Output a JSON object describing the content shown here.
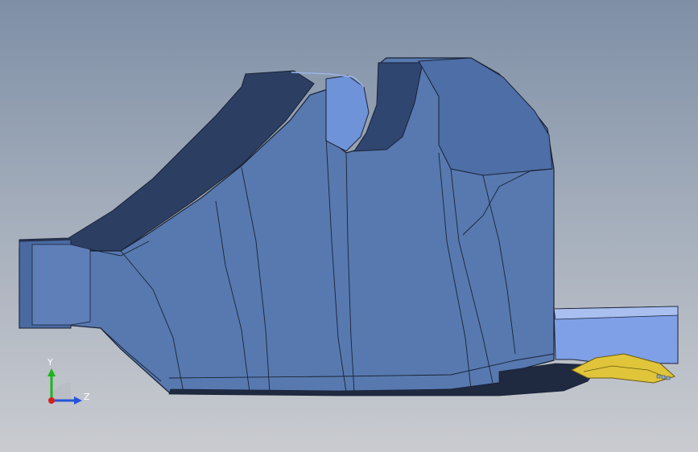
{
  "viewport": {
    "background_top": "#7e8fa6",
    "background_bottom": "#c9cbd0",
    "model_color": "#5779b0",
    "model_shadow_color": "#2c3f63",
    "model_highlight_color": "#8aa6df",
    "edge_color": "#1a2235",
    "accent_part_color": "#e0c43a"
  },
  "triad": {
    "y_label": "Y",
    "z_label": "Z",
    "y_color": "#1db51d",
    "z_color": "#2455d8",
    "x_color": "#d42020"
  }
}
